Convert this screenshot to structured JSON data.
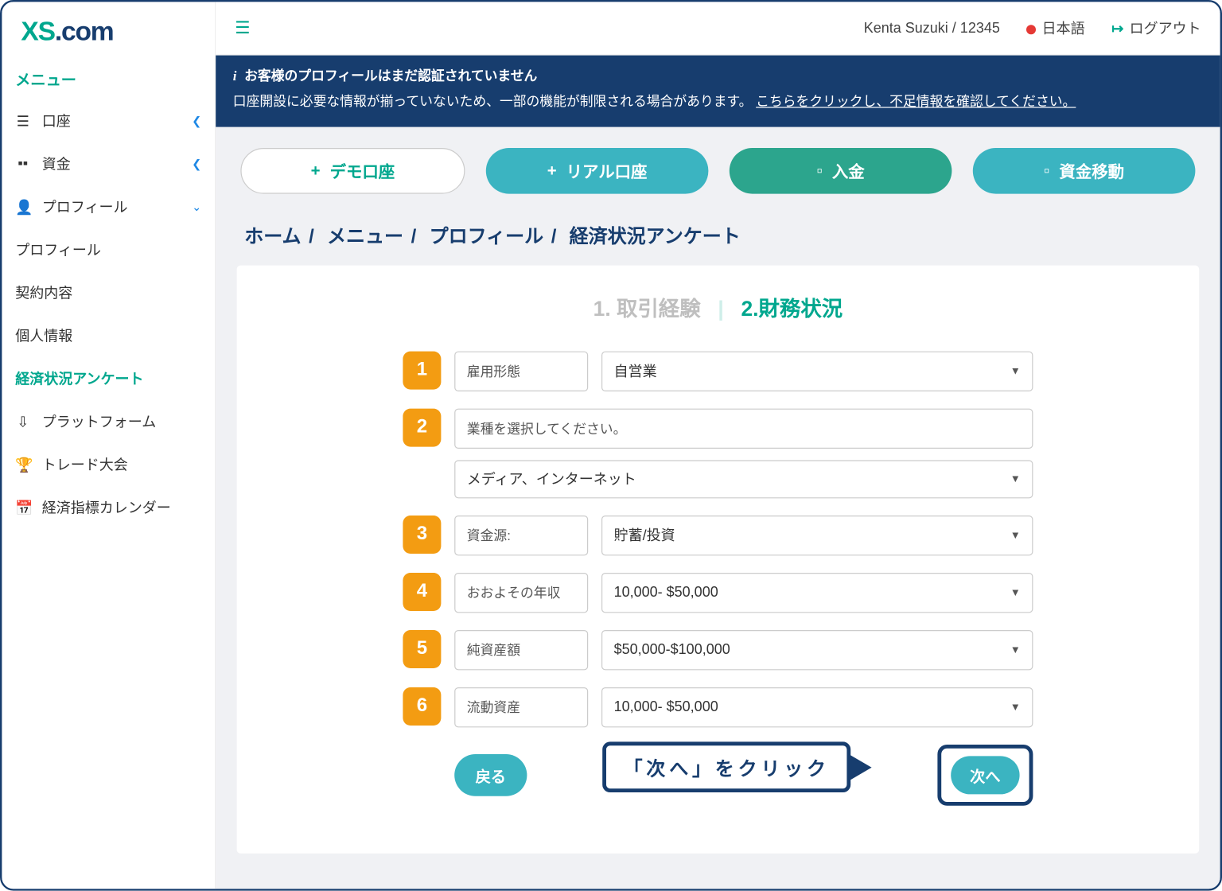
{
  "logo": {
    "x": "X",
    "s": "S",
    "dot": ".",
    "com": "com"
  },
  "sidebar": {
    "menu_label": "メニュー",
    "accounts": "口座",
    "funds": "資金",
    "profile": "プロフィール",
    "sub_profile": "プロフィール",
    "sub_contract": "契約内容",
    "sub_personal": "個人情報",
    "sub_survey": "経済状況アンケート",
    "platform": "プラットフォーム",
    "competition": "トレード大会",
    "calendar": "経済指標カレンダー"
  },
  "topbar": {
    "user": "Kenta Suzuki / 12345",
    "language": "日本語",
    "logout": "ログアウト"
  },
  "notice": {
    "title": "お客様のプロフィールはまだ認証されていません",
    "body": "口座開設に必要な情報が揃っていないため、一部の機能が制限される場合があります。 ",
    "link": "こちらをクリックし、不足情報を確認してください。"
  },
  "actions": {
    "demo": "デモ口座",
    "real": "リアル口座",
    "deposit": "入金",
    "transfer": "資金移動"
  },
  "crumbs": {
    "home": "ホーム",
    "menu": "メニュー",
    "profile": "プロフィール",
    "current": "経済状況アンケート"
  },
  "steps": {
    "s1": "1. 取引経験",
    "s2": "2.財務状況"
  },
  "form": {
    "q1_label": "雇用形態",
    "q1_value": "自営業",
    "q2_label": "業種を選択してください。",
    "q2_value": "メディア、インターネット",
    "q3_label": "資金源:",
    "q3_value": "貯蓄/投資",
    "q4_label": "おおよその年収",
    "q4_value": "10,000- $50,000",
    "q5_label": "純資産額",
    "q5_value": "$50,000-$100,000",
    "q6_label": "流動資産",
    "q6_value": "10,000- $50,000"
  },
  "buttons": {
    "back": "戻る",
    "next": "次へ"
  },
  "callout": "「次へ」をクリック",
  "numbers": [
    "1",
    "2",
    "3",
    "4",
    "5",
    "6"
  ]
}
